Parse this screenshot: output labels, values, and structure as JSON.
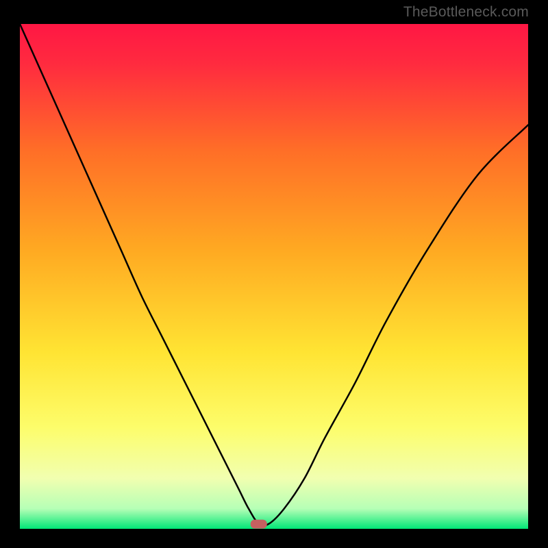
{
  "watermark": "TheBottleneck.com",
  "chart_data": {
    "type": "line",
    "title": "",
    "xlabel": "",
    "ylabel": "",
    "xlim": [
      0,
      100
    ],
    "ylim": [
      0,
      100
    ],
    "gradient_stops": [
      {
        "offset": 0,
        "color": "#ff1744"
      },
      {
        "offset": 8,
        "color": "#ff2b3f"
      },
      {
        "offset": 25,
        "color": "#ff6e27"
      },
      {
        "offset": 45,
        "color": "#ffaa22"
      },
      {
        "offset": 65,
        "color": "#ffe433"
      },
      {
        "offset": 80,
        "color": "#fdfd6b"
      },
      {
        "offset": 90,
        "color": "#f1ffb0"
      },
      {
        "offset": 96,
        "color": "#b6ffb6"
      },
      {
        "offset": 100,
        "color": "#00e676"
      }
    ],
    "marker": {
      "x": 47,
      "y": 1,
      "color": "#c56060"
    },
    "series": [
      {
        "name": "bottleneck-curve",
        "x": [
          0,
          4,
          8,
          12,
          16,
          20,
          24,
          28,
          32,
          36,
          40,
          43,
          45,
          47,
          49,
          52,
          56,
          60,
          66,
          72,
          80,
          90,
          100
        ],
        "y": [
          100,
          91,
          82,
          73,
          64,
          55,
          46,
          38,
          30,
          22,
          14,
          8,
          4,
          1,
          1,
          4,
          10,
          18,
          29,
          41,
          55,
          70,
          80
        ]
      }
    ]
  }
}
